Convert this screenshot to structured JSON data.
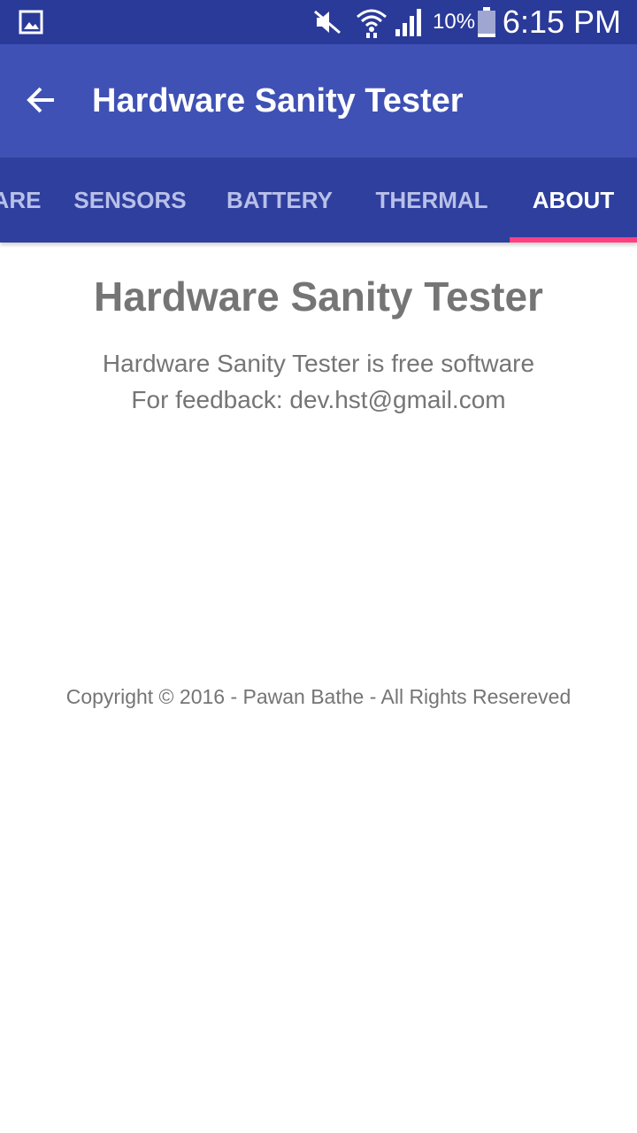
{
  "status_bar": {
    "icons": [
      "image-notification-icon",
      "mute-icon",
      "wifi-icon",
      "signal-icon",
      "battery-icon"
    ],
    "battery_percent": "10%",
    "time": "6:15 PM"
  },
  "app_bar": {
    "back_icon": "arrow-back-icon",
    "title": "Hardware Sanity Tester"
  },
  "tabs": [
    {
      "label": "ARE",
      "active": false
    },
    {
      "label": "SENSORS",
      "active": false
    },
    {
      "label": "BATTERY",
      "active": false
    },
    {
      "label": "THERMAL",
      "active": false
    },
    {
      "label": "ABOUT",
      "active": true
    }
  ],
  "about": {
    "title": "Hardware Sanity Tester",
    "line1": "Hardware Sanity Tester is free software",
    "line2": "For feedback: dev.hst@gmail.com",
    "copyright": "Copyright © 2016 - Pawan Bathe - All Rights Resereved"
  },
  "colors": {
    "status_bar": "#2a3a99",
    "app_bar": "#3f51b5",
    "tab_bar": "#2f3f9e",
    "tab_indicator": "#ff4081",
    "body_text": "#757575"
  }
}
